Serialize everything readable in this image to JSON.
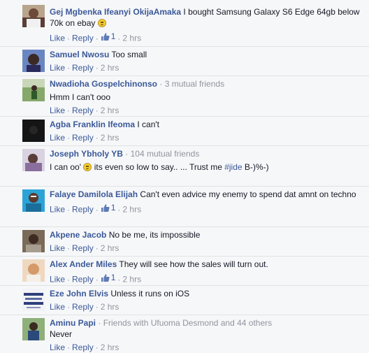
{
  "actions": {
    "like": "Like",
    "reply": "Reply",
    "dot": "·"
  },
  "comments": [
    {
      "author": "Gej Mgbenka Ifeanyi OkijaAmaka",
      "text_before": "I bought Samsung Galaxy S6 Edge 64gb below 70k on ebay",
      "likes": "1",
      "time": "2 hrs",
      "avatar_color": "#7a5a4a"
    },
    {
      "author": "Samuel Nwosu",
      "text": "Too small",
      "time": "2 hrs",
      "avatar_color": "#4a5e9a"
    },
    {
      "author": "Nwadioha Gospelchinonso",
      "meta": "· 3 mutual friends",
      "text": "Hmm I can't ooo",
      "time": "2 hrs",
      "avatar_color": "#4d7a3a"
    },
    {
      "author": "Agba Franklin Ifeoma",
      "text": "I can't",
      "time": "2 hrs",
      "avatar_color": "#1a1a1a"
    },
    {
      "author": "Joseph Ybholy YB",
      "meta": "· 104 mutual friends",
      "text_before": "I can oo'",
      "text_after": "its even so low to say.. ... Trust me",
      "hashtag": "#jide",
      "text_end": "B-)%-)",
      "time": "2 hrs",
      "avatar_color": "#8a7b95"
    },
    {
      "author": "Falaye Damilola Elijah",
      "text": "Can't even advice my enemy to spend dat amnt on techno",
      "likes": "1",
      "time": "2 hrs",
      "avatar_color": "#3aa6c8"
    },
    {
      "author": "Akpene Jacob",
      "text": "No be me, its impossible",
      "time": "2 hrs",
      "avatar_color": "#5a4a3a"
    },
    {
      "author": "Alex Ander Miles",
      "text": "They will see how the sales will turn out.",
      "likes": "1",
      "time": "2 hrs",
      "avatar_color": "#e6b88a"
    },
    {
      "author": "Eze John Elvis",
      "text": "Unless it runs on iOS",
      "time": "2 hrs",
      "avatar_color": "#dfe3ea"
    },
    {
      "author": "Aminu Papi",
      "meta": "· Friends with Ufuoma Desmond and 44 others",
      "text": "Never",
      "time": "2 hrs",
      "avatar_color": "#3a5a2a"
    }
  ]
}
